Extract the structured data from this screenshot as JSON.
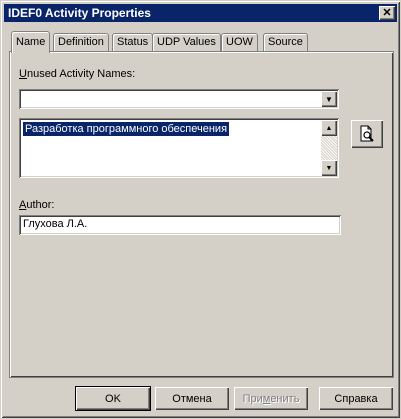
{
  "window": {
    "title": "IDEF0 Activity Properties"
  },
  "tabs": [
    {
      "label": "Name"
    },
    {
      "label": "Definition"
    },
    {
      "label": "Status"
    },
    {
      "label": "UDP Values"
    },
    {
      "label": "UOW"
    },
    {
      "label": "Source"
    }
  ],
  "unused_names": {
    "label_accel": "U",
    "label_rest": "nused Activity Names:",
    "value": ""
  },
  "activity_list": {
    "items": [
      "Разработка программного   обеспечения"
    ]
  },
  "author": {
    "label_accel": "A",
    "label_rest": "uthor:",
    "value": "Глухова Л.А."
  },
  "buttons": {
    "ok": "OK",
    "cancel": "Отмена",
    "apply_pre": "При",
    "apply_accel": "м",
    "apply_post": "енить",
    "help": "Справка"
  },
  "icons": {
    "close": "close-icon",
    "dropdown": "chevron-down-icon",
    "browse": "document-magnifier-icon"
  }
}
